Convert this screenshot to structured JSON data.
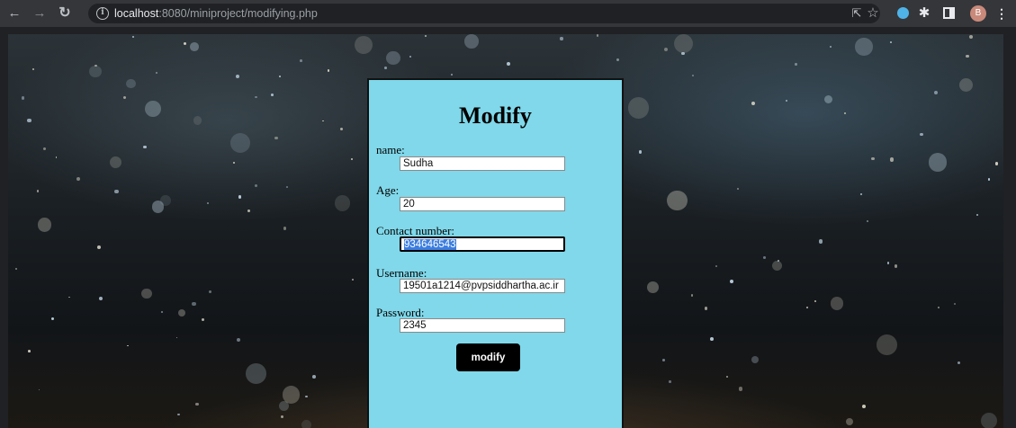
{
  "browser": {
    "url_host": "localhost",
    "url_path": ":8080/miniproject/modifying.php",
    "profile_initial": "B"
  },
  "icons": {
    "back": "arrow-left-icon",
    "forward": "arrow-right-icon",
    "reload": "reload-icon",
    "info": "info-icon",
    "share": "share-icon",
    "bookmark": "star-icon",
    "extension": "extension-icon",
    "extensions": "puzzle-icon",
    "side_panel": "side-panel-icon",
    "menu": "kebab-menu-icon"
  },
  "colors": {
    "panel_bg": "#80d8ea",
    "button_bg": "#000000",
    "selection": "#3d7ee0"
  },
  "form": {
    "title": "Modify",
    "fields": [
      {
        "label": "name:",
        "value": "Sudha"
      },
      {
        "label": "Age:",
        "value": "20"
      },
      {
        "label": "Contact number:",
        "value": "934646543"
      },
      {
        "label": "Username:",
        "value": "19501a1214@pvpsiddhartha.ac.ir"
      },
      {
        "label": "Password:",
        "value": "2345"
      }
    ],
    "submit_label": "modify"
  }
}
